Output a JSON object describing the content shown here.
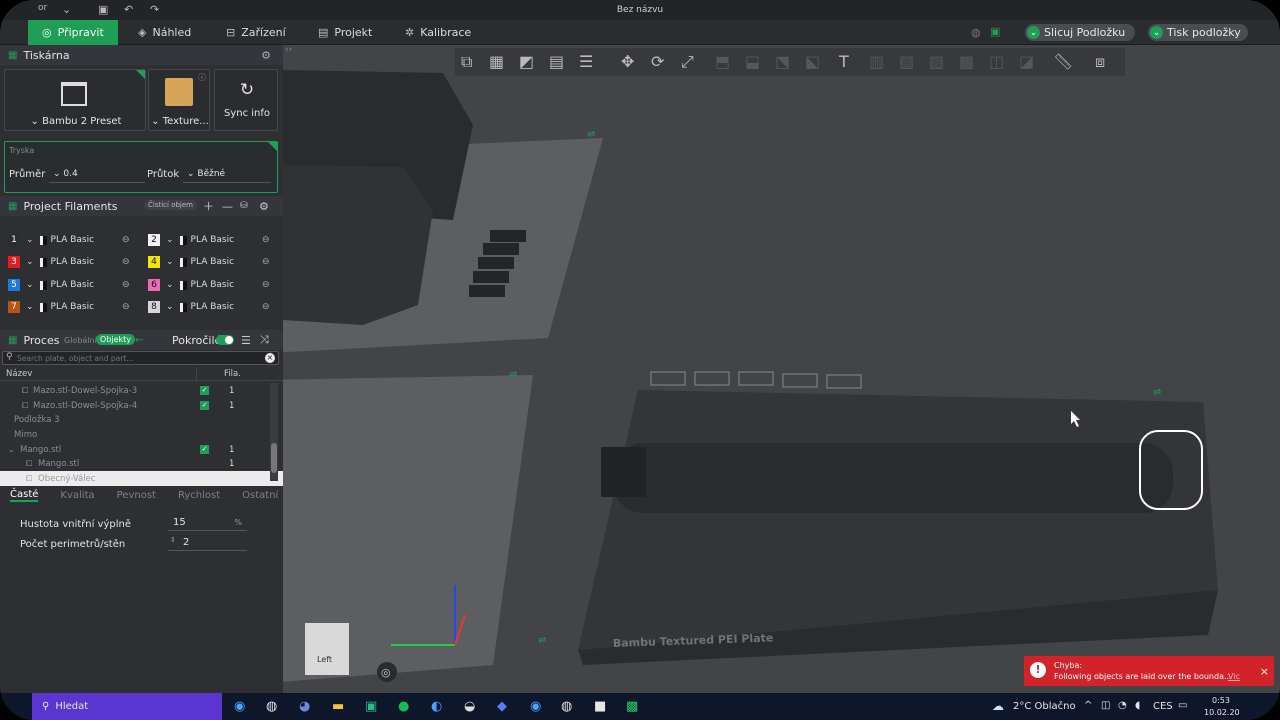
{
  "app": {
    "title": "Bez názvu",
    "menu_left": "or"
  },
  "menubar": {
    "tabs": [
      {
        "label": "Připravit",
        "icon": "prepare-icon"
      },
      {
        "label": "Náhled",
        "icon": "preview-icon"
      },
      {
        "label": "Zařízení",
        "icon": "device-icon"
      },
      {
        "label": "Projekt",
        "icon": "project-icon"
      },
      {
        "label": "Kalibrace",
        "icon": "calibration-icon"
      }
    ],
    "slice_button": "Slicuj Podložku",
    "print_button": "Tisk podložky"
  },
  "printer": {
    "section_title": "Tiskárna",
    "preset": "Bambu 2 Preset",
    "plate": "Texture...",
    "sync": "Sync info",
    "nozzle_label": "Tryska",
    "diameter_label": "Průměr",
    "diameter_value": "0.4",
    "flow_label": "Průtok",
    "flow_value": "Běžné"
  },
  "filaments": {
    "section_title": "Project Filaments",
    "clean_button": "Čisticí objem",
    "items": [
      {
        "num": "1",
        "name": "PLA Basic",
        "color": "#2b2d31",
        "text": "#ffffff"
      },
      {
        "num": "2",
        "name": "PLA Basic",
        "color": "#f2f2f2",
        "text": "#111111"
      },
      {
        "num": "3",
        "name": "PLA Basic",
        "color": "#e02020",
        "text": "#ffffff"
      },
      {
        "num": "4",
        "name": "PLA Basic",
        "color": "#f3e600",
        "text": "#111111"
      },
      {
        "num": "5",
        "name": "PLA Basic",
        "color": "#1e78d6",
        "text": "#ffffff"
      },
      {
        "num": "6",
        "name": "PLA Basic",
        "color": "#f06ab4",
        "text": "#111111"
      },
      {
        "num": "7",
        "name": "PLA Basic",
        "color": "#b5541b",
        "text": "#ffffff"
      },
      {
        "num": "8",
        "name": "PLA Basic",
        "color": "#d6d6d6",
        "text": "#111111"
      }
    ]
  },
  "process": {
    "section_title": "Proces",
    "global": "Globální",
    "objects": "Objekty",
    "advanced": "Pokročilé",
    "search_placeholder": "Search plate, object and part...",
    "col_name": "Název",
    "col_fila": "Fila.",
    "rows": [
      {
        "name": "Mazo.stl-Dowel-Spojka-3",
        "fila": "1",
        "checked": true
      },
      {
        "name": "Mazo.stl-Dowel-Spojka-4",
        "fila": "1",
        "checked": true
      },
      {
        "name": "Podložka 3",
        "fila": "",
        "checked": false
      },
      {
        "name": "Mimo",
        "fila": "",
        "checked": false
      },
      {
        "name": "Mango.stl",
        "fila": "1",
        "checked": true
      },
      {
        "name": "Mango.stl",
        "fila": "1",
        "checked": false
      },
      {
        "name": "Obecný-Válec",
        "fila": "",
        "checked": false
      }
    ],
    "tabs": [
      "Časté",
      "Kvalita",
      "Pevnost",
      "Rychlost",
      "Ostatní"
    ],
    "infill_label": "Hustota vnitřní výplně",
    "infill_value": "15",
    "infill_unit": "%",
    "walls_label": "Počet perimetrů/stěn",
    "walls_value": "2"
  },
  "viewport": {
    "plate_label": "Bambu Textured PEI Plate",
    "view_label": "Left"
  },
  "toast": {
    "title": "Chyba:",
    "message": "Following objects are laid over the bounda...",
    "link": "Vic"
  },
  "taskbar": {
    "search": "Hledat",
    "weather": "2°C  Oblačno",
    "lang": "CES",
    "time": "0:53",
    "date": "10.02.20"
  }
}
